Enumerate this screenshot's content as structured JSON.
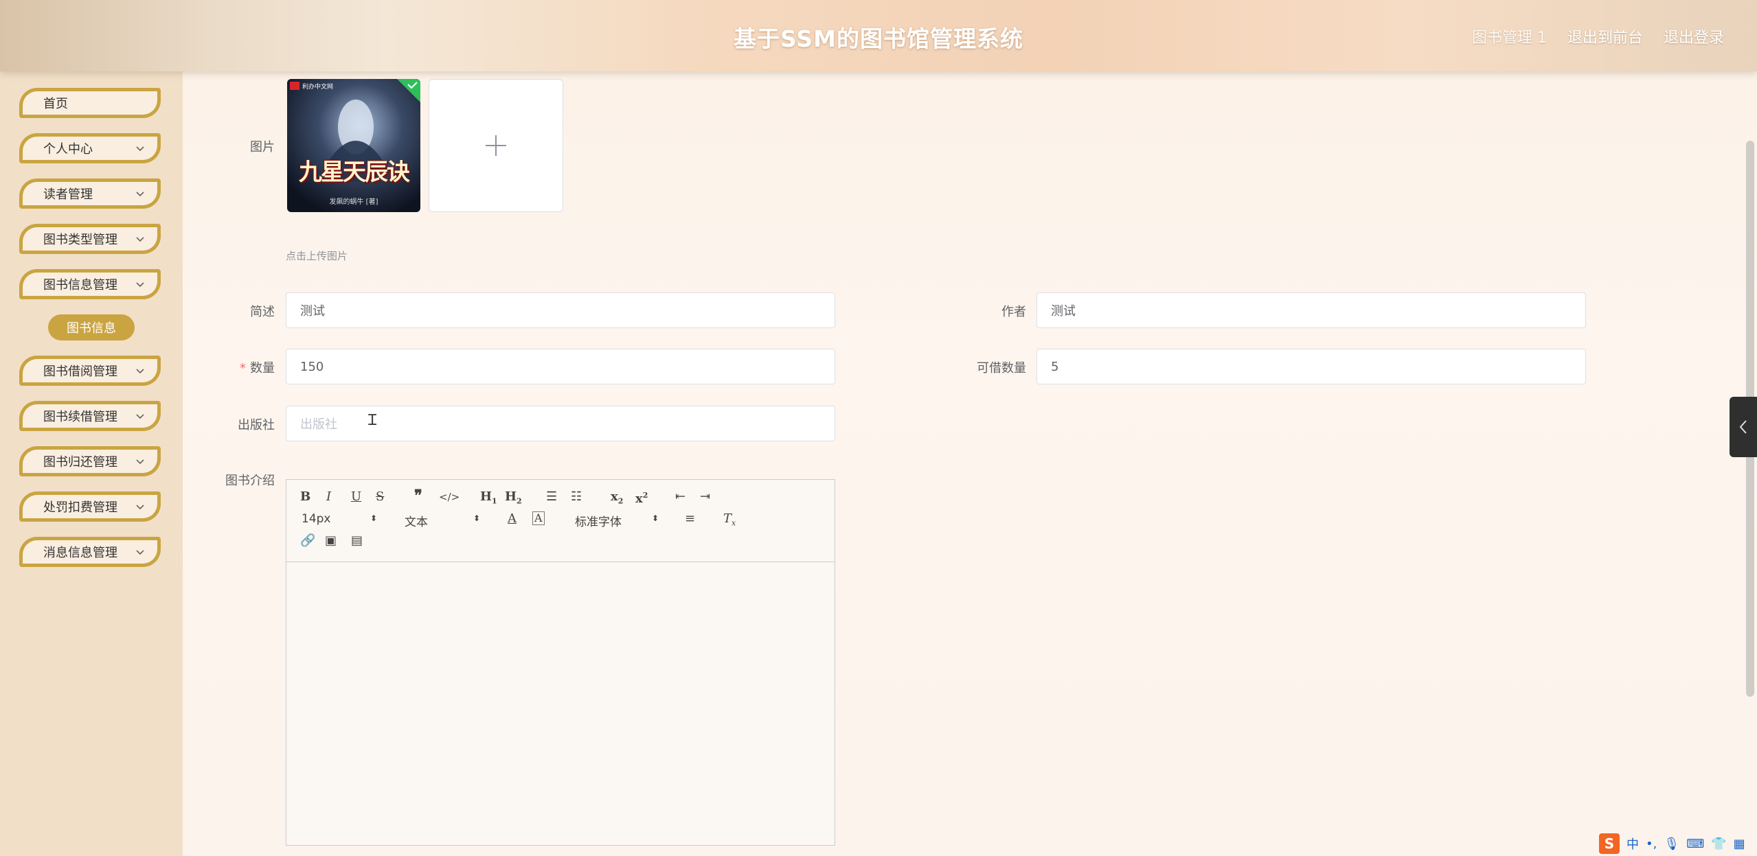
{
  "header": {
    "title": "基于SSM的图书馆管理系统",
    "user_label": "图书管理 1",
    "front_link": "退出到前台",
    "logout_link": "退出登录"
  },
  "sidebar": {
    "items": [
      {
        "label": "首页",
        "has_children": false
      },
      {
        "label": "个人中心",
        "has_children": true
      },
      {
        "label": "读者管理",
        "has_children": true
      },
      {
        "label": "图书类型管理",
        "has_children": true
      },
      {
        "label": "图书信息管理",
        "has_children": true
      },
      {
        "label": "图书借阅管理",
        "has_children": true
      },
      {
        "label": "图书续借管理",
        "has_children": true
      },
      {
        "label": "图书归还管理",
        "has_children": true
      },
      {
        "label": "处罚扣费管理",
        "has_children": true
      },
      {
        "label": "消息信息管理",
        "has_children": true
      }
    ],
    "active_sub": "图书信息"
  },
  "form": {
    "image_label": "图片",
    "cover_badge": "利办中文网",
    "cover_title": "九星天辰诀",
    "cover_author": "发飙的蜗牛 [著]",
    "upload_hint": "点击上传图片",
    "summary_label": "简述",
    "summary_value": "测试",
    "author_label": "作者",
    "author_value": "测试",
    "quantity_label": "数量",
    "quantity_required": "*",
    "quantity_value": "150",
    "borrowable_label": "可借数量",
    "borrowable_value": "5",
    "publisher_label": "出版社",
    "publisher_placeholder": "出版社",
    "intro_label": "图书介绍"
  },
  "editor": {
    "size_value": "14px",
    "header_value": "文本",
    "font_value": "标准字体"
  },
  "ime": {
    "lang": "中"
  },
  "colors": {
    "accent_gold": "#c9a441",
    "sidebar_bg": "#f1dfc8",
    "required_red": "#f56c6c"
  }
}
